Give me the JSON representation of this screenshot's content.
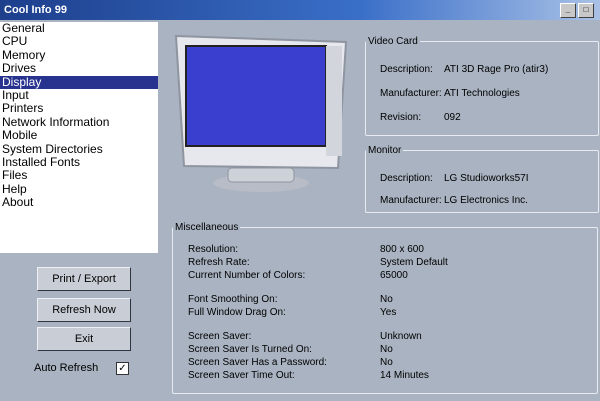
{
  "window": {
    "title": "Cool Info 99",
    "title_controls": [
      "_",
      "□"
    ]
  },
  "nav": {
    "items": [
      {
        "label": "General"
      },
      {
        "label": "CPU"
      },
      {
        "label": "Memory"
      },
      {
        "label": "Drives"
      },
      {
        "label": "Display",
        "selected": true
      },
      {
        "label": "Input"
      },
      {
        "label": "Printers"
      },
      {
        "label": "Network Information"
      },
      {
        "label": "Mobile"
      },
      {
        "label": "System Directories"
      },
      {
        "label": "Installed Fonts"
      },
      {
        "label": "Files"
      },
      {
        "label": "Help"
      },
      {
        "label": "About"
      }
    ]
  },
  "buttons": {
    "print_export": "Print / Export",
    "refresh_now": "Refresh Now",
    "exit": "Exit"
  },
  "auto_refresh": {
    "label": "Auto Refresh",
    "checked": true
  },
  "video_card": {
    "title": "Video Card",
    "fields": [
      {
        "label": "Description:",
        "value": "ATI 3D Rage Pro (atir3)"
      },
      {
        "label": "Manufacturer:",
        "value": "ATI Technologies"
      },
      {
        "label": "Revision:",
        "value": "092"
      }
    ]
  },
  "monitor": {
    "title": "Monitor",
    "fields": [
      {
        "label": "Description:",
        "value": "LG Studioworks57I"
      },
      {
        "label": "Manufacturer:",
        "value": "LG Electronics Inc."
      }
    ]
  },
  "misc": {
    "title": "Miscellaneous",
    "fields": [
      {
        "label": "Resolution:",
        "value": "800 x 600"
      },
      {
        "label": "Refresh Rate:",
        "value": "System Default"
      },
      {
        "label": "Current Number of Colors:",
        "value": "65000"
      },
      {
        "label": "Font Smoothing On:",
        "value": "No"
      },
      {
        "label": "Full Window Drag On:",
        "value": "Yes"
      },
      {
        "label": "Screen Saver:",
        "value": "Unknown"
      },
      {
        "label": "Screen Saver Is Turned On:",
        "value": "No"
      },
      {
        "label": "Screen Saver Has a Password:",
        "value": "No"
      },
      {
        "label": "Screen Saver Time Out:",
        "value": "14 Minutes"
      }
    ]
  },
  "colors": {
    "selection": "#27338f",
    "window_bg": "#a9b3c1",
    "screen": "#3a3fcf"
  }
}
